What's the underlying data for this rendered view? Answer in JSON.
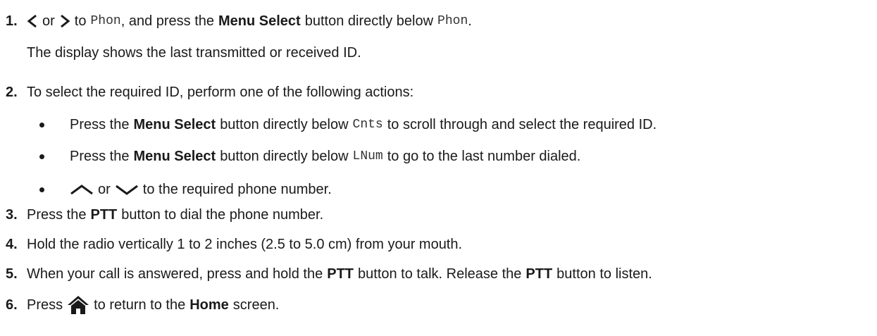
{
  "steps": [
    {
      "number": "1.",
      "parts": {
        "or1": "or",
        "to1": "to",
        "code_phon": "Phon",
        "mid": ", and press the",
        "menu_select": "Menu Select",
        "tail": "button directly below",
        "code_phon2": "Phon",
        "end": "."
      },
      "note": "The display shows the last transmitted or received ID."
    },
    {
      "number": "2.",
      "text": "To select the required ID, perform one of the following actions:",
      "bullets": [
        {
          "pre": "Press the",
          "bold": "Menu Select",
          "mid": "button directly below",
          "code": "Cnts",
          "post": "to scroll through and select the required ID."
        },
        {
          "pre": "Press the",
          "bold": "Menu Select",
          "mid": "button directly below",
          "code": "LNum",
          "post": "to go to the last number dialed."
        },
        {
          "or": "or",
          "post": "to the required phone number."
        }
      ]
    },
    {
      "number": "3.",
      "pre": "Press the",
      "bold": "PTT",
      "post": "button to dial the phone number."
    },
    {
      "number": "4.",
      "text": "Hold the radio vertically 1 to 2 inches (2.5 to 5.0 cm) from your mouth."
    },
    {
      "number": "5.",
      "pre": "When your call is answered, press and hold the",
      "bold1": "PTT",
      "mid": "button to talk. Release the",
      "bold2": "PTT",
      "post": "button to listen."
    },
    {
      "number": "6.",
      "pre": "Press",
      "mid": "to return to the",
      "bold": "Home",
      "post": "screen."
    }
  ],
  "icons": {
    "left": "chevron-left-icon",
    "right": "chevron-right-icon",
    "up": "chevron-up-icon",
    "down": "chevron-down-icon",
    "home": "home-icon"
  }
}
